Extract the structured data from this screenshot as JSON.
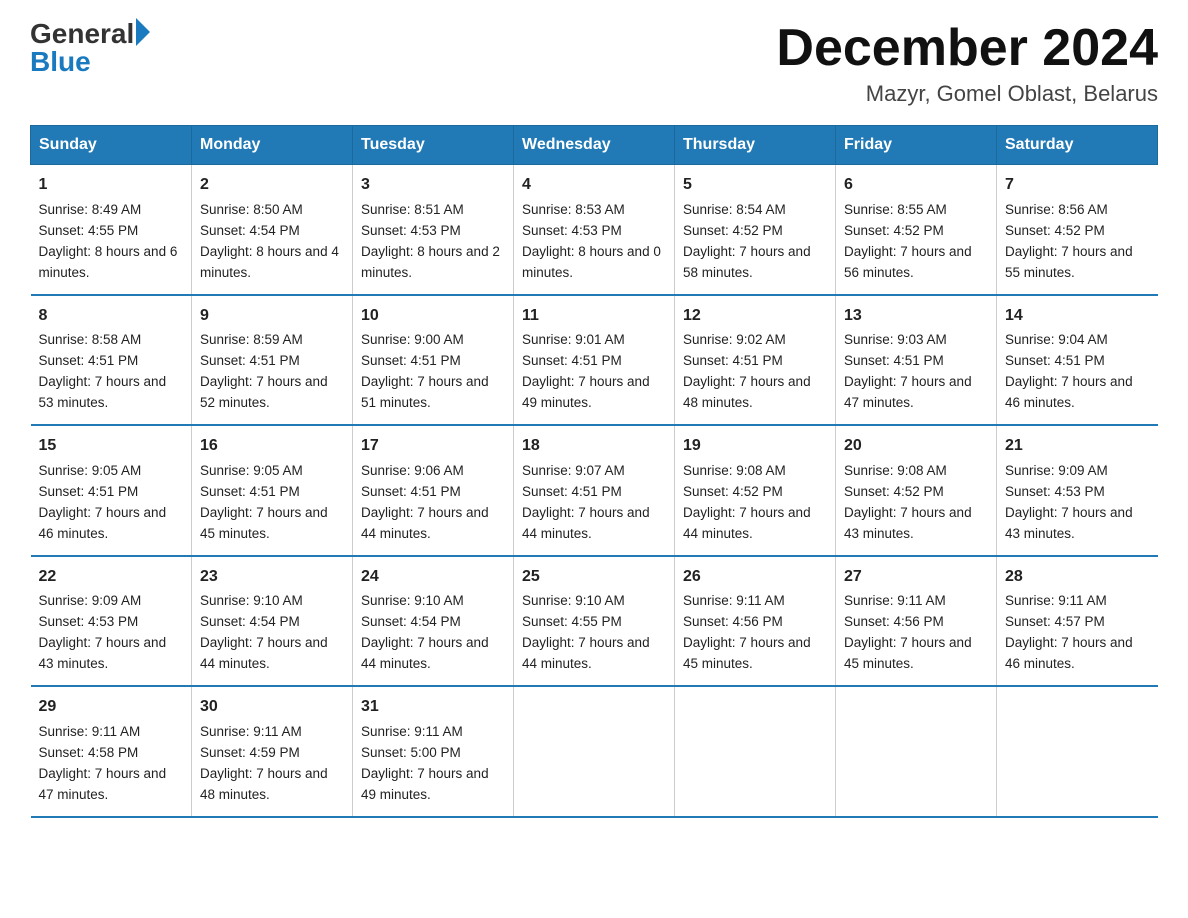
{
  "logo": {
    "general": "General",
    "blue": "Blue"
  },
  "title": "December 2024",
  "location": "Mazyr, Gomel Oblast, Belarus",
  "headers": [
    "Sunday",
    "Monday",
    "Tuesday",
    "Wednesday",
    "Thursday",
    "Friday",
    "Saturday"
  ],
  "weeks": [
    [
      {
        "day": "1",
        "sunrise": "8:49 AM",
        "sunset": "4:55 PM",
        "daylight": "8 hours and 6 minutes."
      },
      {
        "day": "2",
        "sunrise": "8:50 AM",
        "sunset": "4:54 PM",
        "daylight": "8 hours and 4 minutes."
      },
      {
        "day": "3",
        "sunrise": "8:51 AM",
        "sunset": "4:53 PM",
        "daylight": "8 hours and 2 minutes."
      },
      {
        "day": "4",
        "sunrise": "8:53 AM",
        "sunset": "4:53 PM",
        "daylight": "8 hours and 0 minutes."
      },
      {
        "day": "5",
        "sunrise": "8:54 AM",
        "sunset": "4:52 PM",
        "daylight": "7 hours and 58 minutes."
      },
      {
        "day": "6",
        "sunrise": "8:55 AM",
        "sunset": "4:52 PM",
        "daylight": "7 hours and 56 minutes."
      },
      {
        "day": "7",
        "sunrise": "8:56 AM",
        "sunset": "4:52 PM",
        "daylight": "7 hours and 55 minutes."
      }
    ],
    [
      {
        "day": "8",
        "sunrise": "8:58 AM",
        "sunset": "4:51 PM",
        "daylight": "7 hours and 53 minutes."
      },
      {
        "day": "9",
        "sunrise": "8:59 AM",
        "sunset": "4:51 PM",
        "daylight": "7 hours and 52 minutes."
      },
      {
        "day": "10",
        "sunrise": "9:00 AM",
        "sunset": "4:51 PM",
        "daylight": "7 hours and 51 minutes."
      },
      {
        "day": "11",
        "sunrise": "9:01 AM",
        "sunset": "4:51 PM",
        "daylight": "7 hours and 49 minutes."
      },
      {
        "day": "12",
        "sunrise": "9:02 AM",
        "sunset": "4:51 PM",
        "daylight": "7 hours and 48 minutes."
      },
      {
        "day": "13",
        "sunrise": "9:03 AM",
        "sunset": "4:51 PM",
        "daylight": "7 hours and 47 minutes."
      },
      {
        "day": "14",
        "sunrise": "9:04 AM",
        "sunset": "4:51 PM",
        "daylight": "7 hours and 46 minutes."
      }
    ],
    [
      {
        "day": "15",
        "sunrise": "9:05 AM",
        "sunset": "4:51 PM",
        "daylight": "7 hours and 46 minutes."
      },
      {
        "day": "16",
        "sunrise": "9:05 AM",
        "sunset": "4:51 PM",
        "daylight": "7 hours and 45 minutes."
      },
      {
        "day": "17",
        "sunrise": "9:06 AM",
        "sunset": "4:51 PM",
        "daylight": "7 hours and 44 minutes."
      },
      {
        "day": "18",
        "sunrise": "9:07 AM",
        "sunset": "4:51 PM",
        "daylight": "7 hours and 44 minutes."
      },
      {
        "day": "19",
        "sunrise": "9:08 AM",
        "sunset": "4:52 PM",
        "daylight": "7 hours and 44 minutes."
      },
      {
        "day": "20",
        "sunrise": "9:08 AM",
        "sunset": "4:52 PM",
        "daylight": "7 hours and 43 minutes."
      },
      {
        "day": "21",
        "sunrise": "9:09 AM",
        "sunset": "4:53 PM",
        "daylight": "7 hours and 43 minutes."
      }
    ],
    [
      {
        "day": "22",
        "sunrise": "9:09 AM",
        "sunset": "4:53 PM",
        "daylight": "7 hours and 43 minutes."
      },
      {
        "day": "23",
        "sunrise": "9:10 AM",
        "sunset": "4:54 PM",
        "daylight": "7 hours and 44 minutes."
      },
      {
        "day": "24",
        "sunrise": "9:10 AM",
        "sunset": "4:54 PM",
        "daylight": "7 hours and 44 minutes."
      },
      {
        "day": "25",
        "sunrise": "9:10 AM",
        "sunset": "4:55 PM",
        "daylight": "7 hours and 44 minutes."
      },
      {
        "day": "26",
        "sunrise": "9:11 AM",
        "sunset": "4:56 PM",
        "daylight": "7 hours and 45 minutes."
      },
      {
        "day": "27",
        "sunrise": "9:11 AM",
        "sunset": "4:56 PM",
        "daylight": "7 hours and 45 minutes."
      },
      {
        "day": "28",
        "sunrise": "9:11 AM",
        "sunset": "4:57 PM",
        "daylight": "7 hours and 46 minutes."
      }
    ],
    [
      {
        "day": "29",
        "sunrise": "9:11 AM",
        "sunset": "4:58 PM",
        "daylight": "7 hours and 47 minutes."
      },
      {
        "day": "30",
        "sunrise": "9:11 AM",
        "sunset": "4:59 PM",
        "daylight": "7 hours and 48 minutes."
      },
      {
        "day": "31",
        "sunrise": "9:11 AM",
        "sunset": "5:00 PM",
        "daylight": "7 hours and 49 minutes."
      },
      null,
      null,
      null,
      null
    ]
  ],
  "labels": {
    "sunrise": "Sunrise:",
    "sunset": "Sunset:",
    "daylight": "Daylight:"
  }
}
